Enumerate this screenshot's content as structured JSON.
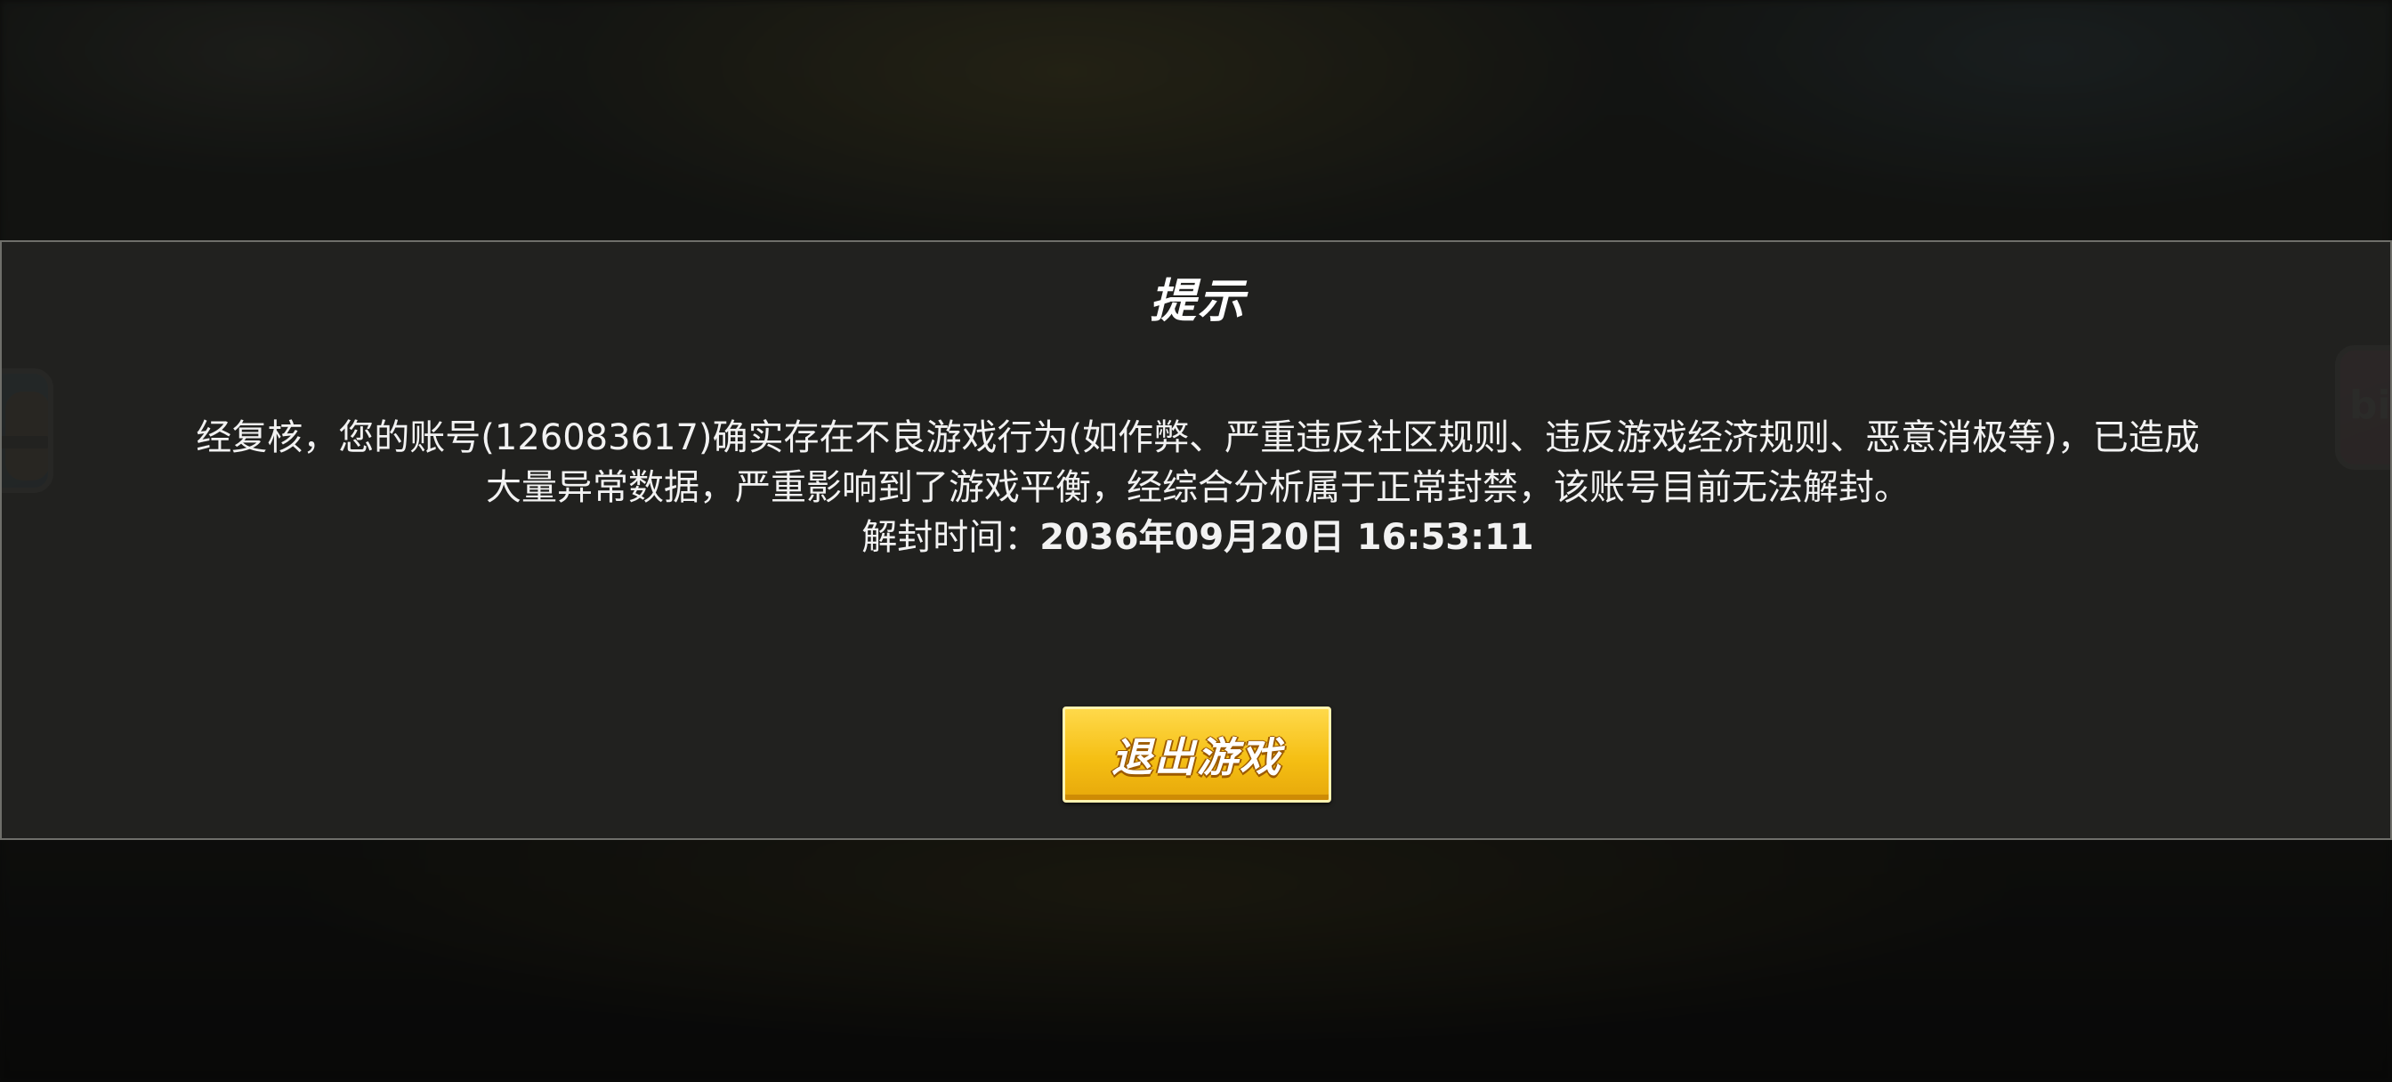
{
  "dialog": {
    "title": "提示",
    "message": "经复核，您的账号(126083617)确实存在不良游戏行为(如作弊、严重违反社区规则、违反游戏经济规则、恶意消极等)，已造成大量异常数据，严重影响到了游戏平衡，经综合分析属于正常封禁，该账号目前无法解封。",
    "unban_label": "解封时间：",
    "unban_time": "2036年09月20日 16:53:11",
    "exit_button_label": "退出游戏"
  },
  "side_icons": {
    "right_mark_text": "bi"
  }
}
